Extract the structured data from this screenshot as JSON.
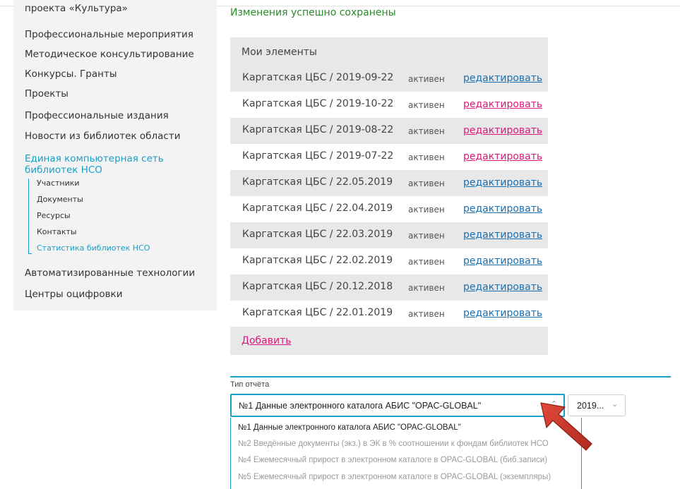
{
  "notice": "Изменения успешно сохранены",
  "sidebar": {
    "items": [
      {
        "label": "проекта «Культура»"
      },
      {
        "label": "Профессиональные мероприятия"
      },
      {
        "label": "Методическое консультирование"
      },
      {
        "label": "Конкурсы. Гранты"
      },
      {
        "label": "Проекты"
      },
      {
        "label": "Профессиональные издания"
      },
      {
        "label": "Новости из библиотек области"
      },
      {
        "label": "Единая компьютерная сеть библиотек НСО"
      },
      {
        "label": "Автоматизированные технологии"
      },
      {
        "label": "Центры оцифровки"
      }
    ],
    "subitems": [
      {
        "label": "Участники"
      },
      {
        "label": "Документы"
      },
      {
        "label": "Ресурсы"
      },
      {
        "label": "Контакты"
      },
      {
        "label": "Статистика библиотек НСО"
      }
    ]
  },
  "elements": {
    "header": "Мои элементы",
    "edit_label": "редактировать",
    "add_label": "Добавить",
    "rows": [
      {
        "title": "Каргатская ЦБС / 2019-09-22",
        "status": "активен"
      },
      {
        "title": "Каргатская ЦБС / 2019-10-22",
        "status": "активен"
      },
      {
        "title": "Каргатская ЦБС / 2019-08-22",
        "status": "активен"
      },
      {
        "title": "Каргатская ЦБС / 2019-07-22",
        "status": "активен"
      },
      {
        "title": "Каргатская ЦБС / 22.05.2019",
        "status": "активен"
      },
      {
        "title": "Каргатская ЦБС / 22.04.2019",
        "status": "активен"
      },
      {
        "title": "Каргатская ЦБС / 22.03.2019",
        "status": "активен"
      },
      {
        "title": "Каргатская ЦБС / 22.02.2019",
        "status": "активен"
      },
      {
        "title": "Каргатская ЦБС / 20.12.2018",
        "status": "активен"
      },
      {
        "title": "Каргатская ЦБС / 22.01.2019",
        "status": "активен"
      }
    ]
  },
  "report": {
    "label": "Тип отчёта",
    "selected": "№1 Данные электронного каталога АБИС \"OPAC-GLOBAL\"",
    "year_selected": "2019...",
    "options": [
      "№1 Данные электронного каталога АБИС \"OPAC-GLOBAL\"",
      "№2 Введённые документы (экз.) в ЭК в % соотношении к фондам библиотек НСО",
      "№4 Ежемесячный прирост в электронном каталоге в OPAC-GLOBAL (биб.записи)",
      "№5 Ежемесячный прирост в электронном каталоге в OPAC-GLOBAL (экземпляры)"
    ]
  },
  "colors": {
    "accent": "#1aa0c6",
    "link_blue": "#1a6fb0",
    "link_magenta": "#d81b7a",
    "success": "#2b8a2b",
    "arrow": "#c0392b"
  },
  "icons": {
    "select_chevron": "chevron-down-icon",
    "annotation": "arrow-icon"
  }
}
